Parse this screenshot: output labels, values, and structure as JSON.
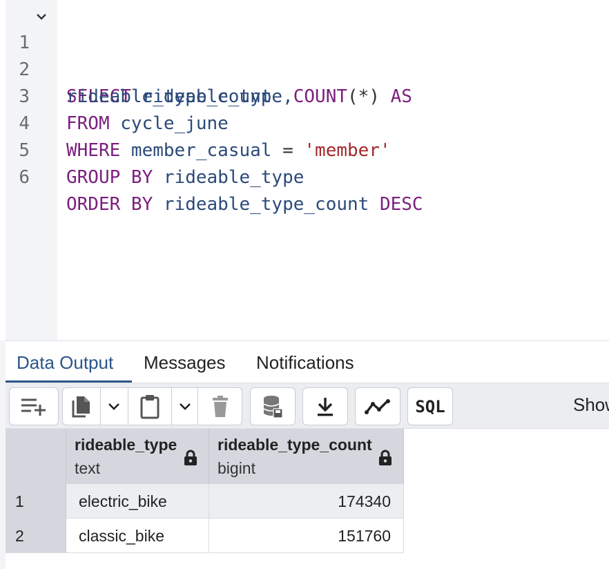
{
  "editor": {
    "lines": [
      {
        "num": "1",
        "tokens": [
          {
            "t": "kw",
            "v": "SELECT"
          },
          {
            "t": "id",
            "v": " rideable_type,"
          },
          {
            "t": "kw",
            "v": "COUNT"
          },
          {
            "t": "op",
            "v": "(*)"
          },
          {
            "t": "kw",
            "v": " AS"
          }
        ]
      },
      {
        "num": "2",
        "tokens": [
          {
            "t": "id",
            "v": "rideable_type_count"
          }
        ]
      },
      {
        "num": "3",
        "tokens": [
          {
            "t": "kw",
            "v": "FROM"
          },
          {
            "t": "id",
            "v": " cycle_june"
          }
        ]
      },
      {
        "num": "4",
        "tokens": [
          {
            "t": "kw",
            "v": "WHERE"
          },
          {
            "t": "id",
            "v": " member_casual"
          },
          {
            "t": "op",
            "v": " = "
          },
          {
            "t": "str",
            "v": "'member'"
          }
        ]
      },
      {
        "num": "5",
        "tokens": [
          {
            "t": "kw",
            "v": "GROUP BY"
          },
          {
            "t": "id",
            "v": " rideable_type"
          }
        ]
      },
      {
        "num": "6",
        "tokens": [
          {
            "t": "kw",
            "v": "ORDER BY"
          },
          {
            "t": "id",
            "v": " rideable_type_count"
          },
          {
            "t": "kw",
            "v": " DESC"
          }
        ]
      }
    ]
  },
  "tabs": {
    "data_output": "Data Output",
    "messages": "Messages",
    "notifications": "Notifications"
  },
  "toolbar": {
    "sql_label": "SQL",
    "show_label": "Show"
  },
  "grid": {
    "columns": [
      {
        "name": "rideable_type",
        "type": "text"
      },
      {
        "name": "rideable_type_count",
        "type": "bigint"
      }
    ],
    "rows": [
      {
        "num": "1",
        "rideable_type": "electric_bike",
        "count": "174340"
      },
      {
        "num": "2",
        "rideable_type": "classic_bike",
        "count": "151760"
      }
    ]
  },
  "colors": {
    "keyword": "#7a1f7e",
    "identifier": "#2b4a7a",
    "string": "#a3282c",
    "accent": "#2a5587"
  }
}
